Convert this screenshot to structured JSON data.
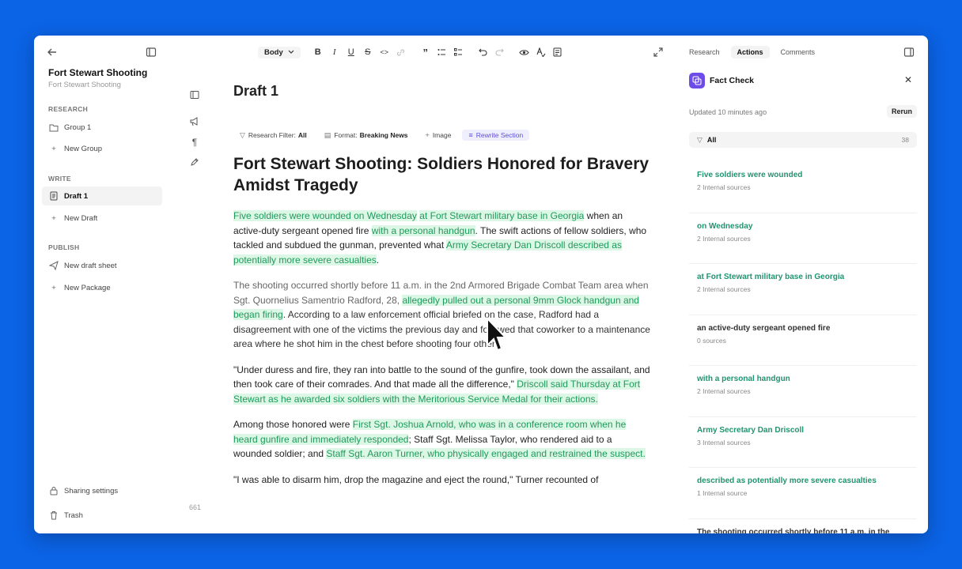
{
  "sidebar": {
    "title": "Fort Stewart Shooting",
    "subtitle": "Fort Stewart Shooting",
    "research_label": "RESEARCH",
    "group_label": "Group 1",
    "new_group_label": "New Group",
    "write_label": "WRITE",
    "draft_label": "Draft 1",
    "new_draft_label": "New Draft",
    "publish_label": "PUBLISH",
    "new_draft_sheet_label": "New draft sheet",
    "new_package_label": "New Package",
    "sharing_label": "Sharing settings",
    "trash_label": "Trash"
  },
  "toolbar": {
    "style_select": "Body"
  },
  "editor": {
    "draft_title": "Draft 1",
    "word_count": "661",
    "chips": {
      "research_filter_label": "Research Filter:",
      "research_filter_value": "All",
      "format_label": "Format:",
      "format_value": "Breaking News",
      "image_label": "Image",
      "rewrite_label": "Rewrite Section"
    },
    "headline": "Fort Stewart Shooting: Soldiers Honored for Bravery Amidst Tragedy",
    "p1": {
      "h1": "Five soldiers were wounded on Wednesday",
      "s1": " ",
      "h2": "at Fort Stewart military base in Georgia",
      "t1": " when an active-duty sergeant opened fire ",
      "h3": "with a personal handgun",
      "t2": ". The swift actions of fellow soldiers, who tackled and subdued the gunman, prevented what ",
      "h4": "Army Secretary Dan Driscoll described as potentially more severe casualties",
      "t3": "."
    },
    "p2": {
      "t1": "The shooting occurred shortly before 11 a.m. in the 2nd Armored Brigade Combat Team area when Sgt. Quornelius Samentrio Radford, 28, ",
      "h1": "allegedly pulled out a personal 9mm Glock handgun and began firing",
      "t2": ". According to a law enforcement official briefed on the case, Radford had a disagreement with one of the victims the previous day and followed that coworker to a maintenance area where he shot him in the chest before shooting four others."
    },
    "p3": {
      "t1": "\"Under duress and fire, they ran into battle to the sound of the gunfire, took down the assailant, and then took care of their comrades. And that made all the difference,\" ",
      "h1": "Driscoll said Thursday at Fort Stewart as he awarded six soldiers with the Meritorious Service Medal for their actions."
    },
    "p4": {
      "t1": "Among those honored were ",
      "h1": "First Sgt. Joshua Arnold, who was in a conference room when he heard gunfire and immediately responded",
      "t2": "; Staff Sgt. Melissa Taylor, who rendered aid to a wounded soldier; and ",
      "h2": "Staff Sgt. Aaron Turner, who physically engaged and restrained the suspect."
    },
    "p5": "\"I was able to disarm him, drop the magazine and eject the round,\" Turner recounted of"
  },
  "panel": {
    "tabs": [
      "Research",
      "Actions",
      "Comments"
    ],
    "fact_check_title": "Fact Check",
    "updated": "Updated 10 minutes ago",
    "rerun": "Rerun",
    "filter_label": "All",
    "filter_count": "38",
    "claims": [
      {
        "text": "Five soldiers were wounded",
        "sources": "2 Internal sources"
      },
      {
        "text": "on Wednesday",
        "sources": "2 Internal sources"
      },
      {
        "text": "at Fort Stewart military base in Georgia",
        "sources": "2 Internal sources"
      },
      {
        "text": "an active-duty sergeant opened fire",
        "sources": "0 sources"
      },
      {
        "text": "with a personal handgun",
        "sources": "2 Internal sources"
      },
      {
        "text": "Army Secretary Dan Driscoll",
        "sources": "3 Internal sources"
      },
      {
        "text": "described as potentially more severe casualties",
        "sources": "1 Internal source"
      },
      {
        "text": "The shooting occurred shortly before 11 a.m. in the",
        "sources": ""
      }
    ]
  },
  "colors": {
    "background": "#0b63e5",
    "highlight_bg": "#dcf7e5",
    "highlight_text": "#1f9a5c",
    "accent": "#6d4ce8"
  }
}
